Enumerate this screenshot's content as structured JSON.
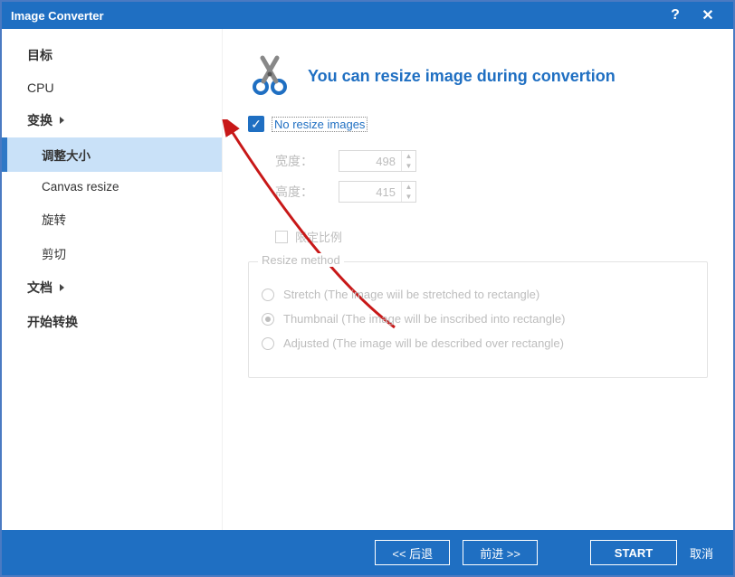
{
  "window": {
    "title": "Image Converter"
  },
  "sidebar": {
    "items": [
      {
        "label": "目标"
      },
      {
        "label": "CPU"
      },
      {
        "label": "变换"
      },
      {
        "label": "文档"
      },
      {
        "label": "开始转换"
      }
    ],
    "transform_subitems": [
      {
        "label": "调整大小"
      },
      {
        "label": "Canvas resize"
      },
      {
        "label": "旋转"
      },
      {
        "label": "剪切"
      }
    ]
  },
  "content": {
    "header_title": "You can resize image during convertion",
    "no_resize_label": "No resize images",
    "width_label": "宽度：",
    "height_label": "高度：",
    "width_value": "498",
    "height_value": "415",
    "proportional_label": "限定比例",
    "fieldset_title": "Resize method",
    "radios": [
      {
        "label": "Stretch (The image wiil be stretched to rectangle)"
      },
      {
        "label": "Thumbnail  (The image will be inscribed into rectangle)"
      },
      {
        "label": "Adjusted (The image will be described over rectangle)"
      }
    ]
  },
  "footer": {
    "back_label": "<<  后退",
    "forward_label": "前进  >>",
    "start_label": "START",
    "cancel_label": "取消"
  }
}
